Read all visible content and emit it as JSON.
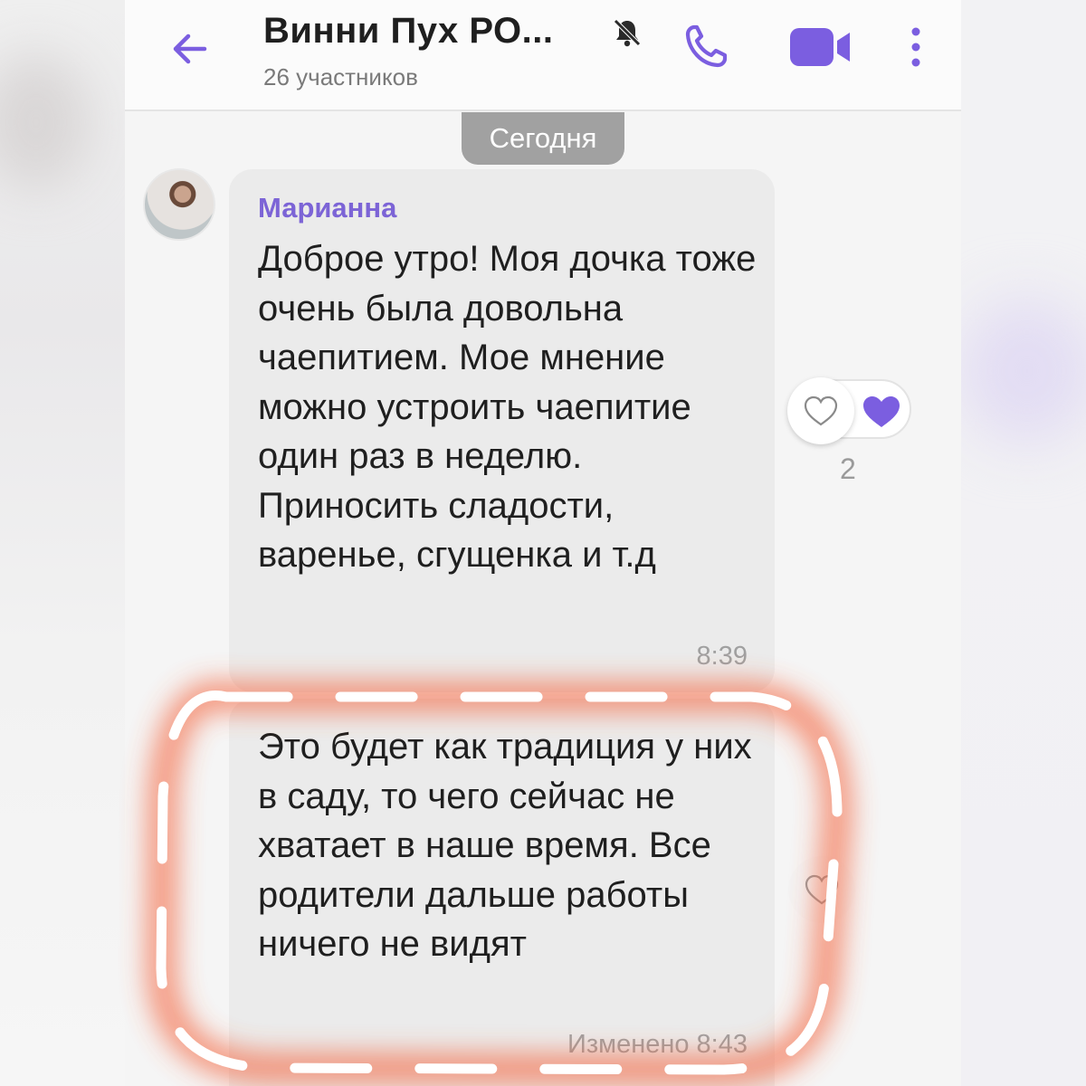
{
  "header": {
    "title": "Винни Пух  РО...",
    "subtitle": "26 участников",
    "back_icon": "arrow-left-icon",
    "mute_icon": "muted-bell-icon",
    "call_icon": "phone-icon",
    "video_icon": "video-camera-icon",
    "menu_icon": "more-vertical-icon",
    "accent_color": "#7b5ee0"
  },
  "date_separator": "Сегодня",
  "messages": [
    {
      "sender": "Марианна",
      "text": "Доброе утро! Моя дочка тоже очень была довольна чаепитием. Мое мнение можно устроить чаепитие один раз в неделю. Приносить сладости, варенье, сгущенка и т.д",
      "time": "8:39",
      "reactions": {
        "count": "2",
        "icon": "heart-icon"
      }
    },
    {
      "text": "Это будет как традиция у них в саду, то чего сейчас не хватает в наше время. Все родители дальше работы ничего не видят",
      "time": "Изменено 8:43",
      "highlighted": true,
      "highlight_color": "#f4623a"
    }
  ]
}
